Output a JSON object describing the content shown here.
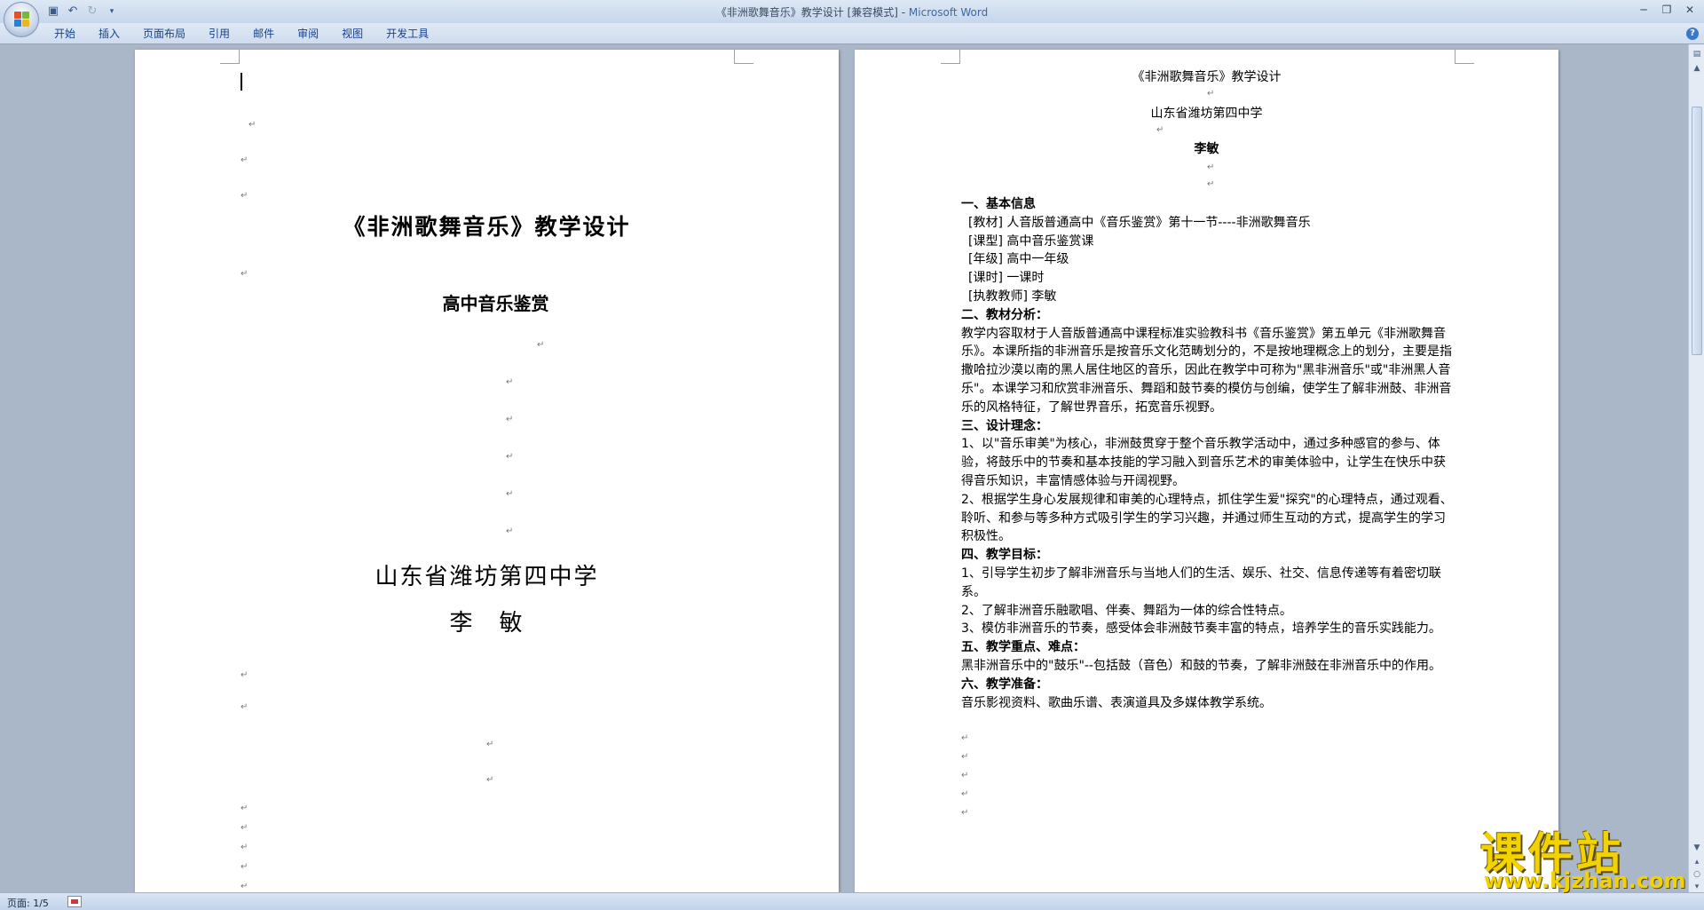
{
  "window": {
    "title_doc": "《非洲歌舞音乐》教学设计 [兼容模式] - ",
    "title_app": "Microsoft Word"
  },
  "quick_access": [
    "save-icon",
    "undo-icon",
    "redo-icon",
    "customize-icon"
  ],
  "ribbon": {
    "tabs": [
      "开始",
      "插入",
      "页面布局",
      "引用",
      "邮件",
      "审阅",
      "视图",
      "开发工具"
    ]
  },
  "page_left": {
    "title": "《非洲歌舞音乐》教学设计",
    "subtitle": "高中音乐鉴赏",
    "school": "山东省潍坊第四中学",
    "author": "李　敏",
    "mark": "↵"
  },
  "page_right": {
    "title": "《非洲歌舞音乐》教学设计",
    "school": "山东省潍坊第四中学",
    "author": "李敏",
    "sections": [
      {
        "heading": "一、基本信息",
        "items": [
          "[教材] 人音版普通高中《音乐鉴赏》第十一节----非洲歌舞音乐",
          "[课型]   高中音乐鉴赏课",
          "[年级] 高中一年级",
          "[课时] 一课时",
          "[执教教师] 李敏"
        ]
      },
      {
        "heading": "二、教材分析：",
        "paragraphs": [
          "教学内容取材于人音版普通高中课程标准实验教科书《音乐鉴赏》第五单元《非洲歌舞音乐》。本课所指的非洲音乐是按音乐文化范畴划分的，不是按地理概念上的划分，主要是指撒哈拉沙漠以南的黑人居住地区的音乐，因此在教学中可称为\"黑非洲音乐\"或\"非洲黑人音乐\"。本课学习和欣赏非洲音乐、舞蹈和鼓节奏的模仿与创编，使学生了解非洲鼓、非洲音乐的风格特征，了解世界音乐，拓宽音乐视野。"
        ]
      },
      {
        "heading": "三、设计理念：",
        "paragraphs": [
          "1、以\"音乐审美\"为核心，非洲鼓贯穿于整个音乐教学活动中，通过多种感官的参与、体验，将鼓乐中的节奏和基本技能的学习融入到音乐艺术的审美体验中，让学生在快乐中获得音乐知识，丰富情感体验与开阔视野。",
          "2、根据学生身心发展规律和审美的心理特点，抓住学生爱\"探究\"的心理特点，通过观看、聆听、和参与等多种方式吸引学生的学习兴趣，并通过师生互动的方式，提高学生的学习积极性。"
        ]
      },
      {
        "heading": "四、教学目标：",
        "paragraphs": [
          "1、引导学生初步了解非洲音乐与当地人们的生活、娱乐、社交、信息传递等有着密切联系。",
          "2、了解非洲音乐融歌唱、伴奏、舞蹈为一体的综合性特点。",
          "3、模仿非洲音乐的节奏，感受体会非洲鼓节奏丰富的特点，培养学生的音乐实践能力。"
        ]
      },
      {
        "heading": "五、教学重点、难点：",
        "paragraphs": [
          "黑非洲音乐中的\"鼓乐\"--包括鼓（音色）和鼓的节奏，了解非洲鼓在非洲音乐中的作用。"
        ]
      },
      {
        "heading": "六、教学准备：",
        "paragraphs": [
          "音乐影视资料、歌曲乐谱、表演道具及多媒体教学系统。"
        ]
      }
    ]
  },
  "status": {
    "page": "页面: 1/5"
  },
  "watermark": {
    "main": "课件站",
    "url": "www.kjzhan.com"
  }
}
